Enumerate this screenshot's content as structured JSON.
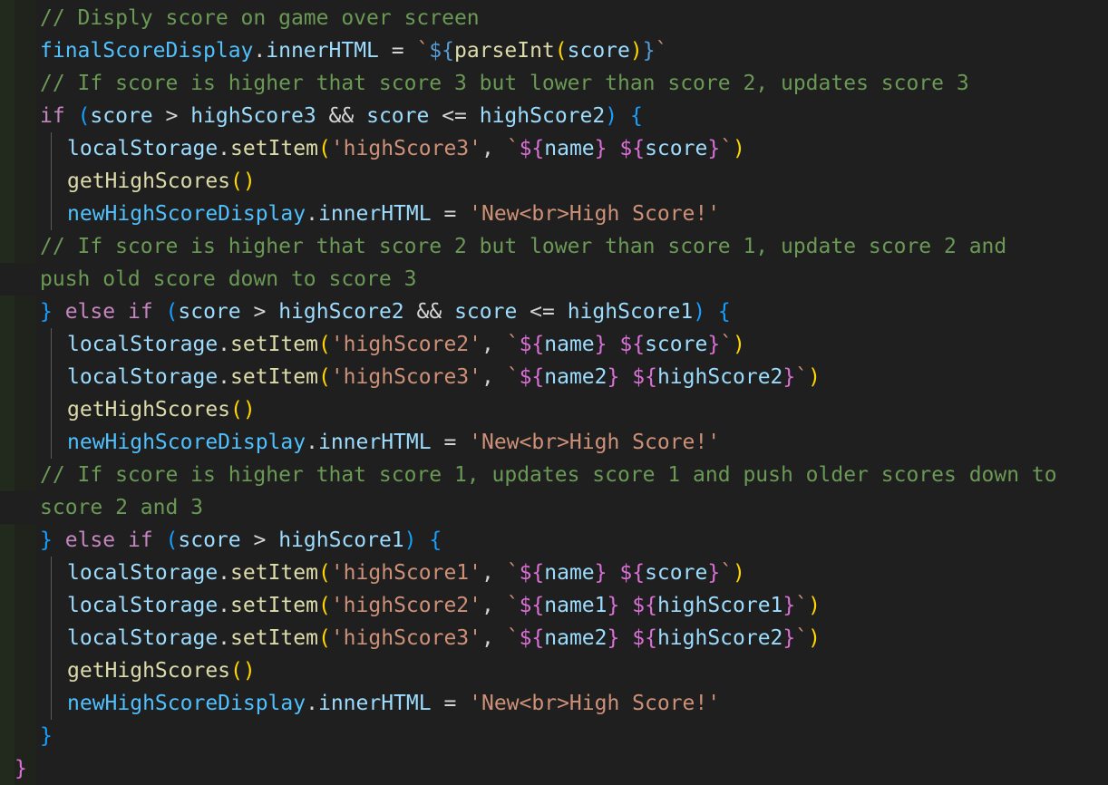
{
  "editor": {
    "language": "javascript",
    "colors": {
      "background": "#1f1f1f",
      "comment": "#6a9955",
      "variable": "#4fc1ff",
      "function": "#dcdcaa",
      "string": "#ce9178",
      "keyword": "#c586c0",
      "property": "#9cdcfe",
      "bracket_gold": "#ffd700",
      "bracket_purple": "#da70d6",
      "bracket_blue": "#179fff"
    },
    "lines": [
      [
        {
          "t": "// Disply score on game over screen",
          "c": "cmt"
        }
      ],
      [
        {
          "t": "finalScoreDisplay",
          "c": "var"
        },
        {
          "t": ".",
          "c": "pl"
        },
        {
          "t": "innerHTML",
          "c": "txv"
        },
        {
          "t": " = ",
          "c": "pl"
        },
        {
          "t": "`",
          "c": "str"
        },
        {
          "t": "${",
          "c": "kwb"
        },
        {
          "t": "parseInt",
          "c": "fn"
        },
        {
          "t": "(",
          "c": "br1"
        },
        {
          "t": "score",
          "c": "txv"
        },
        {
          "t": ")",
          "c": "br1"
        },
        {
          "t": "}",
          "c": "kwb"
        },
        {
          "t": "`",
          "c": "str"
        }
      ],
      [
        {
          "t": "// If score is higher that score 3 but lower than score 2, updates score 3",
          "c": "cmt"
        }
      ],
      [
        {
          "t": "if",
          "c": "kw"
        },
        {
          "t": " ",
          "c": "pl"
        },
        {
          "t": "(",
          "c": "br3"
        },
        {
          "t": "score",
          "c": "txv"
        },
        {
          "t": " > ",
          "c": "pl"
        },
        {
          "t": "highScore3",
          "c": "txv"
        },
        {
          "t": " && ",
          "c": "pl"
        },
        {
          "t": "score",
          "c": "txv"
        },
        {
          "t": " <= ",
          "c": "pl"
        },
        {
          "t": "highScore2",
          "c": "txv"
        },
        {
          "t": ")",
          "c": "br3"
        },
        {
          "t": " ",
          "c": "pl"
        },
        {
          "t": "{",
          "c": "br3"
        }
      ],
      [
        {
          "t": "localStorage",
          "c": "txv"
        },
        {
          "t": ".",
          "c": "pl"
        },
        {
          "t": "setItem",
          "c": "fn"
        },
        {
          "t": "(",
          "c": "br1"
        },
        {
          "t": "'highScore3'",
          "c": "str"
        },
        {
          "t": ", ",
          "c": "pl"
        },
        {
          "t": "`",
          "c": "str"
        },
        {
          "t": "${",
          "c": "br2"
        },
        {
          "t": "name",
          "c": "txv"
        },
        {
          "t": "}",
          "c": "br2"
        },
        {
          "t": " ",
          "c": "str"
        },
        {
          "t": "${",
          "c": "br2"
        },
        {
          "t": "score",
          "c": "txv"
        },
        {
          "t": "}",
          "c": "br2"
        },
        {
          "t": "`",
          "c": "str"
        },
        {
          "t": ")",
          "c": "br1"
        }
      ],
      [
        {
          "t": "getHighScores",
          "c": "fn"
        },
        {
          "t": "()",
          "c": "br1"
        }
      ],
      [
        {
          "t": "newHighScoreDisplay",
          "c": "var"
        },
        {
          "t": ".",
          "c": "pl"
        },
        {
          "t": "innerHTML",
          "c": "txv"
        },
        {
          "t": " = ",
          "c": "pl"
        },
        {
          "t": "'New<br>High Score!'",
          "c": "str"
        }
      ],
      [
        {
          "t": "// If score is higher that score 2 but lower than score 1, update score 2 and",
          "c": "cmt"
        }
      ],
      [
        {
          "t": "push old score down to score 3",
          "c": "cmt"
        }
      ],
      [
        {
          "t": "}",
          "c": "br3"
        },
        {
          "t": " ",
          "c": "pl"
        },
        {
          "t": "else",
          "c": "kw"
        },
        {
          "t": " ",
          "c": "pl"
        },
        {
          "t": "if",
          "c": "kw"
        },
        {
          "t": " ",
          "c": "pl"
        },
        {
          "t": "(",
          "c": "br3"
        },
        {
          "t": "score",
          "c": "txv"
        },
        {
          "t": " > ",
          "c": "pl"
        },
        {
          "t": "highScore2",
          "c": "txv"
        },
        {
          "t": " && ",
          "c": "pl"
        },
        {
          "t": "score",
          "c": "txv"
        },
        {
          "t": " <= ",
          "c": "pl"
        },
        {
          "t": "highScore1",
          "c": "txv"
        },
        {
          "t": ")",
          "c": "br3"
        },
        {
          "t": " ",
          "c": "pl"
        },
        {
          "t": "{",
          "c": "br3"
        }
      ],
      [
        {
          "t": "localStorage",
          "c": "txv"
        },
        {
          "t": ".",
          "c": "pl"
        },
        {
          "t": "setItem",
          "c": "fn"
        },
        {
          "t": "(",
          "c": "br1"
        },
        {
          "t": "'highScore2'",
          "c": "str"
        },
        {
          "t": ", ",
          "c": "pl"
        },
        {
          "t": "`",
          "c": "str"
        },
        {
          "t": "${",
          "c": "br2"
        },
        {
          "t": "name",
          "c": "txv"
        },
        {
          "t": "}",
          "c": "br2"
        },
        {
          "t": " ",
          "c": "str"
        },
        {
          "t": "${",
          "c": "br2"
        },
        {
          "t": "score",
          "c": "txv"
        },
        {
          "t": "}",
          "c": "br2"
        },
        {
          "t": "`",
          "c": "str"
        },
        {
          "t": ")",
          "c": "br1"
        }
      ],
      [
        {
          "t": "localStorage",
          "c": "txv"
        },
        {
          "t": ".",
          "c": "pl"
        },
        {
          "t": "setItem",
          "c": "fn"
        },
        {
          "t": "(",
          "c": "br1"
        },
        {
          "t": "'highScore3'",
          "c": "str"
        },
        {
          "t": ", ",
          "c": "pl"
        },
        {
          "t": "`",
          "c": "str"
        },
        {
          "t": "${",
          "c": "br2"
        },
        {
          "t": "name2",
          "c": "txv"
        },
        {
          "t": "}",
          "c": "br2"
        },
        {
          "t": " ",
          "c": "str"
        },
        {
          "t": "${",
          "c": "br2"
        },
        {
          "t": "highScore2",
          "c": "txv"
        },
        {
          "t": "}",
          "c": "br2"
        },
        {
          "t": "`",
          "c": "str"
        },
        {
          "t": ")",
          "c": "br1"
        }
      ],
      [
        {
          "t": "getHighScores",
          "c": "fn"
        },
        {
          "t": "()",
          "c": "br1"
        }
      ],
      [
        {
          "t": "newHighScoreDisplay",
          "c": "var"
        },
        {
          "t": ".",
          "c": "pl"
        },
        {
          "t": "innerHTML",
          "c": "txv"
        },
        {
          "t": " = ",
          "c": "pl"
        },
        {
          "t": "'New<br>High Score!'",
          "c": "str"
        }
      ],
      [
        {
          "t": "// If score is higher that score 1, updates score 1 and push older scores down to",
          "c": "cmt"
        }
      ],
      [
        {
          "t": "score 2 and 3",
          "c": "cmt"
        }
      ],
      [
        {
          "t": "}",
          "c": "br3"
        },
        {
          "t": " ",
          "c": "pl"
        },
        {
          "t": "else",
          "c": "kw"
        },
        {
          "t": " ",
          "c": "pl"
        },
        {
          "t": "if",
          "c": "kw"
        },
        {
          "t": " ",
          "c": "pl"
        },
        {
          "t": "(",
          "c": "br3"
        },
        {
          "t": "score",
          "c": "txv"
        },
        {
          "t": " > ",
          "c": "pl"
        },
        {
          "t": "highScore1",
          "c": "txv"
        },
        {
          "t": ")",
          "c": "br3"
        },
        {
          "t": " ",
          "c": "pl"
        },
        {
          "t": "{",
          "c": "br3"
        }
      ],
      [
        {
          "t": "localStorage",
          "c": "txv"
        },
        {
          "t": ".",
          "c": "pl"
        },
        {
          "t": "setItem",
          "c": "fn"
        },
        {
          "t": "(",
          "c": "br1"
        },
        {
          "t": "'highScore1'",
          "c": "str"
        },
        {
          "t": ", ",
          "c": "pl"
        },
        {
          "t": "`",
          "c": "str"
        },
        {
          "t": "${",
          "c": "br2"
        },
        {
          "t": "name",
          "c": "txv"
        },
        {
          "t": "}",
          "c": "br2"
        },
        {
          "t": " ",
          "c": "str"
        },
        {
          "t": "${",
          "c": "br2"
        },
        {
          "t": "score",
          "c": "txv"
        },
        {
          "t": "}",
          "c": "br2"
        },
        {
          "t": "`",
          "c": "str"
        },
        {
          "t": ")",
          "c": "br1"
        }
      ],
      [
        {
          "t": "localStorage",
          "c": "txv"
        },
        {
          "t": ".",
          "c": "pl"
        },
        {
          "t": "setItem",
          "c": "fn"
        },
        {
          "t": "(",
          "c": "br1"
        },
        {
          "t": "'highScore2'",
          "c": "str"
        },
        {
          "t": ", ",
          "c": "pl"
        },
        {
          "t": "`",
          "c": "str"
        },
        {
          "t": "${",
          "c": "br2"
        },
        {
          "t": "name1",
          "c": "txv"
        },
        {
          "t": "}",
          "c": "br2"
        },
        {
          "t": " ",
          "c": "str"
        },
        {
          "t": "${",
          "c": "br2"
        },
        {
          "t": "highScore1",
          "c": "txv"
        },
        {
          "t": "}",
          "c": "br2"
        },
        {
          "t": "`",
          "c": "str"
        },
        {
          "t": ")",
          "c": "br1"
        }
      ],
      [
        {
          "t": "localStorage",
          "c": "txv"
        },
        {
          "t": ".",
          "c": "pl"
        },
        {
          "t": "setItem",
          "c": "fn"
        },
        {
          "t": "(",
          "c": "br1"
        },
        {
          "t": "'highScore3'",
          "c": "str"
        },
        {
          "t": ", ",
          "c": "pl"
        },
        {
          "t": "`",
          "c": "str"
        },
        {
          "t": "${",
          "c": "br2"
        },
        {
          "t": "name2",
          "c": "txv"
        },
        {
          "t": "}",
          "c": "br2"
        },
        {
          "t": " ",
          "c": "str"
        },
        {
          "t": "${",
          "c": "br2"
        },
        {
          "t": "highScore2",
          "c": "txv"
        },
        {
          "t": "}",
          "c": "br2"
        },
        {
          "t": "`",
          "c": "str"
        },
        {
          "t": ")",
          "c": "br1"
        }
      ],
      [
        {
          "t": "getHighScores",
          "c": "fn"
        },
        {
          "t": "()",
          "c": "br1"
        }
      ],
      [
        {
          "t": "newHighScoreDisplay",
          "c": "var"
        },
        {
          "t": ".",
          "c": "pl"
        },
        {
          "t": "innerHTML",
          "c": "txv"
        },
        {
          "t": " = ",
          "c": "pl"
        },
        {
          "t": "'New<br>High Score!'",
          "c": "str"
        }
      ],
      [
        {
          "t": "}",
          "c": "br3"
        }
      ],
      [
        {
          "t": "}",
          "c": "br2"
        }
      ]
    ]
  }
}
